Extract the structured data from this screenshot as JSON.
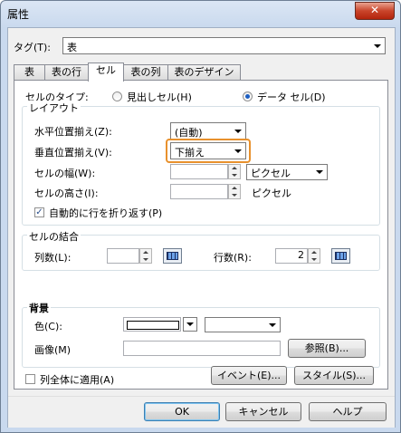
{
  "window": {
    "title": "属性",
    "close_glyph": "✕"
  },
  "tag": {
    "label": "タグ(T):",
    "value": "表"
  },
  "tabs": [
    "表",
    "表の行",
    "セル",
    "表の列",
    "表のデザイン"
  ],
  "cell_type": {
    "label": "セルのタイプ:",
    "option_header": "見出しセル(H)",
    "option_data": "データ セル(D)",
    "selected": "データ セル(D)"
  },
  "layout": {
    "legend": "レイアウト",
    "halign_label": "水平位置揃え(Z):",
    "halign_value": "(自動)",
    "valign_label": "垂直位置揃え(V):",
    "valign_value": "下揃え",
    "width_label": "セルの幅(W):",
    "width_unit": "ピクセル",
    "height_label": "セルの高さ(I):",
    "height_unit": "ピクセル",
    "wrap_label": "自動的に行を折り返す(P)",
    "wrap_checked": true
  },
  "merge": {
    "legend": "セルの結合",
    "cols_label": "列数(L):",
    "cols_value": "",
    "rows_label": "行数(R):",
    "rows_value": "2"
  },
  "background": {
    "legend": "背景",
    "color_label": "色(C):",
    "image_label": "画像(M)",
    "browse_label": "参照(B)..."
  },
  "apply_all": {
    "label": "列全体に適用(A)",
    "checked": false
  },
  "buttons": {
    "event": "イベント(E)...",
    "style": "スタイル(S)...",
    "ok": "OK",
    "cancel": "キャンセル",
    "help": "ヘルプ"
  },
  "colors": {
    "focus_border": "#e8912d",
    "radio_on": "#1c5ec2"
  }
}
